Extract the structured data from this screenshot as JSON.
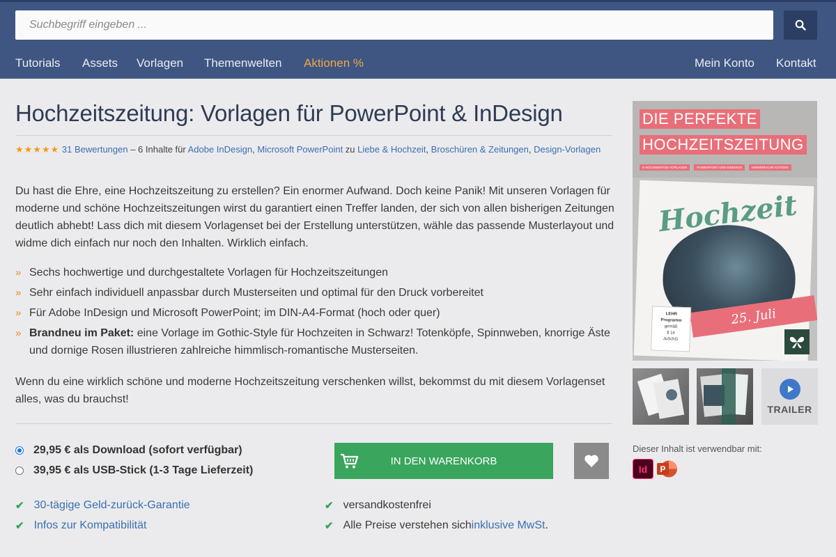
{
  "colors": {
    "header_bg": "#3f5682",
    "accent_orange": "#f0a64a",
    "link_blue": "#3a6fb0",
    "cart_green": "#3aa55d",
    "title_color": "#2f3b55"
  },
  "search": {
    "placeholder": "Suchbegriff eingeben ...",
    "button_icon": "search-icon"
  },
  "nav": {
    "left": [
      "Tutorials",
      "Assets",
      "Vorlagen",
      "Themenwelten",
      "Aktionen %"
    ],
    "right": [
      "Mein Konto",
      "Kontakt"
    ]
  },
  "product": {
    "title": "Hochzeitszeitung: Vorlagen für PowerPoint & InDesign",
    "rating": {
      "stars": "★★★★★",
      "star_count": 5,
      "reviews_link": "31 Bewertungen",
      "contents_text": " – 6 Inhalte für ",
      "software": [
        "Adobe InDesign",
        "Microsoft PowerPoint"
      ],
      "to_text": " zu ",
      "categories": [
        "Liebe & Hochzeit",
        "Broschüren & Zeitungen",
        "Design-Vorlagen"
      ]
    },
    "description": "Du hast die Ehre, eine Hochzeitszeitung zu erstellen? Ein enormer Aufwand. Doch keine Panik! Mit unseren Vorlagen für moderne und schöne Hochzeitszeitungen wirst du garantiert einen Treffer landen, der sich von allen bisherigen Zeitungen deutlich abhebt! Lass dich mit diesem Vorlagenset bei der Erstellung unterstützen, wähle das passende Musterlayout und widme dich einfach nur noch den Inhalten. Wirklich einfach.",
    "bullets": [
      {
        "bold": "",
        "text": "Sechs hochwertige und durchgestaltete Vorlagen für Hochzeitszeitungen"
      },
      {
        "bold": "",
        "text": "Sehr einfach individuell anpassbar durch Musterseiten und optimal für den Druck vorbereitet"
      },
      {
        "bold": "",
        "text": "Für Adobe InDesign und Microsoft PowerPoint; im DIN-A4-Format (hoch oder quer)"
      },
      {
        "bold": "Brandneu im Paket:",
        "text": " eine Vorlage im Gothic-Style für Hochzeiten in Schwarz! Totenköpfe, Spinnweben, knorrige Äste und dornige Rosen illustrieren zahlreiche himmlisch-romantische Musterseiten."
      }
    ],
    "outro": "Wenn du eine wirklich schöne und moderne Hochzeitszeitung verschenken willst, bekommst du mit diesem Vorlagenset alles, was du brauchst!"
  },
  "purchase": {
    "options": [
      {
        "label": "29,95 € als Download (sofort verfügbar)",
        "selected": true
      },
      {
        "label": "39,95 € als USB-Stick (1-3 Tage Lieferzeit)",
        "selected": false
      }
    ],
    "cart_label": "IN DEN WARENKORB",
    "cart_icon": "shopping-cart-icon",
    "wishlist_icon": "heart-icon",
    "features_left": [
      {
        "link": "30-tägige Geld-zurück-Garantie"
      },
      {
        "link": "Infos zur Kompatibilität"
      }
    ],
    "features_right": [
      {
        "text": "versandkostenfrei"
      },
      {
        "prefix": "Alle Preise verstehen sich ",
        "link": "inklusive MwSt",
        "suffix": "."
      }
    ]
  },
  "cover": {
    "headline_1": "DIE PERFEKTE",
    "headline_2": "HOCHZEITSZEITUNG",
    "tags": [
      "6 HOCHWERTIGE VORLAGEN",
      "POWERPOINT UND INDESIGN",
      "HIMMERKICHE KOTZIEN"
    ],
    "script_title": "Hochzeit",
    "ribbon_text": "25. Juli",
    "badge_lines": [
      "LEHR",
      "Programm",
      "gemäß",
      "§ 14",
      "JuSchG"
    ],
    "logo_icon": "butterfly-logo-icon"
  },
  "gallery": {
    "trailer_label": "TRAILER",
    "play_icon": "play-icon"
  },
  "compat": {
    "label": "Dieser Inhalt ist verwendbar mit:",
    "apps": [
      {
        "name": "Adobe InDesign",
        "short": "Id",
        "icon": "indesign-icon"
      },
      {
        "name": "Microsoft PowerPoint",
        "short": "P",
        "icon": "powerpoint-icon"
      }
    ]
  }
}
